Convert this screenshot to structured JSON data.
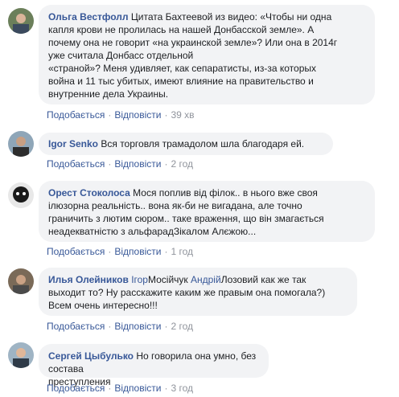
{
  "comments": [
    {
      "author": "Ольга Вестфолл",
      "lines": [
        "Цитата Бахтеевой из видео: «Чтобы ни одна",
        "капля крови не пролилась на нашей Донбасской земле». А",
        "почему она не говорит «на украинской земле»? Или она в 2014г",
        "уже считала Донбасс отдельной",
        "«страной»? Меня удивляет, как сепаратисты, из-за которых",
        "война и 11 тыс убитых, имеют влияние на правительство и",
        "внутренние дела Украины."
      ],
      "like": "Подобається",
      "reply": "Відповісти",
      "time": "39 хв"
    },
    {
      "author": "Igor Senko",
      "lines": [
        "Вся торговля трамадолом шла благодаря ей."
      ],
      "like": "Подобається",
      "reply": "Відповісти",
      "time": "2 год"
    },
    {
      "author": "Орест Стоколоса",
      "lines": [
        "Мося поплив від філок.. в нього вже своя",
        "ілюзорна реальність.. вона як-би не вигадана, але точно",
        "граничить з лютим сюром.. таке враження, що він змагається",
        "неадекватністю з альфарадЗікалом Алєжою..."
      ],
      "like": "Подобається",
      "reply": "Відповісти",
      "time": "1 год"
    },
    {
      "author": "Илья Олейников",
      "mention1": "Ігор",
      "text1": "Мосійчук ",
      "mention2": "Андрій",
      "text2": "Лозовий как же так",
      "lines": [
        "выходит то? Ну расскажите каким же правым она помогала?)",
        "Всем очень интересно!!!"
      ],
      "like": "Подобається",
      "reply": "Відповісти",
      "time": "2 год"
    },
    {
      "author": "Сергей Цыбулько",
      "lines": [
        "Но говорила она умно, без состава",
        "преступления"
      ],
      "like": "Подобається",
      "reply": "Відповісти",
      "time": "3 год"
    }
  ]
}
